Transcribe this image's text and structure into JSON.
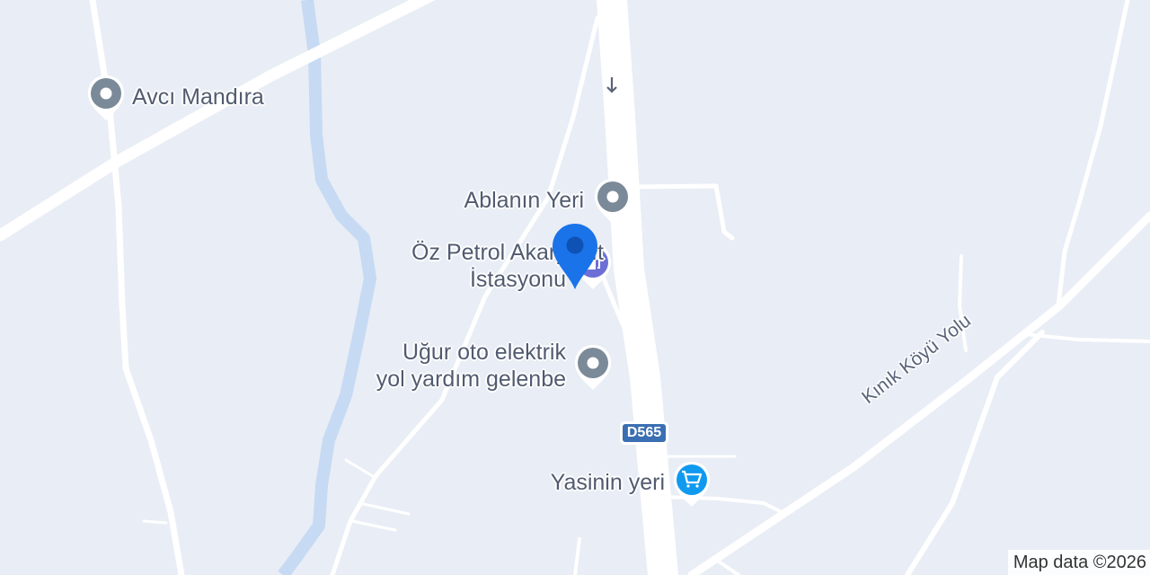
{
  "map": {
    "background_color": "#e9edf5",
    "road_color": "#ffffff",
    "water_color": "#c6daf3",
    "pois": [
      {
        "id": "avci",
        "name": "Avcı Mandıra",
        "icon": "pin-generic-icon",
        "color": "#7b8a98"
      },
      {
        "id": "ablanin",
        "name": "Ablanın Yeri",
        "icon": "pin-generic-icon",
        "color": "#7b8a98"
      },
      {
        "id": "ozpetrol",
        "name_line1": "Öz Petrol Akaryakıt",
        "name_line2": "İstasyonu",
        "icon": "gas-station-icon",
        "color": "#6d6fd6"
      },
      {
        "id": "ugur",
        "name_line1": "Uğur oto elektrik",
        "name_line2": "yol yardım gelenbe",
        "icon": "pin-generic-icon",
        "color": "#7b8a98"
      },
      {
        "id": "yasinin",
        "name": "Yasinin yeri",
        "icon": "shopping-cart-icon",
        "color": "#0f9af0"
      }
    ],
    "road_shield": {
      "label": "D565",
      "color": "#3b6fb3"
    },
    "road_label": "Kınık Köyü Yolu",
    "marker": {
      "icon": "location-marker-icon",
      "color": "#1a73e8"
    },
    "attribution": "Map data ©2026"
  }
}
